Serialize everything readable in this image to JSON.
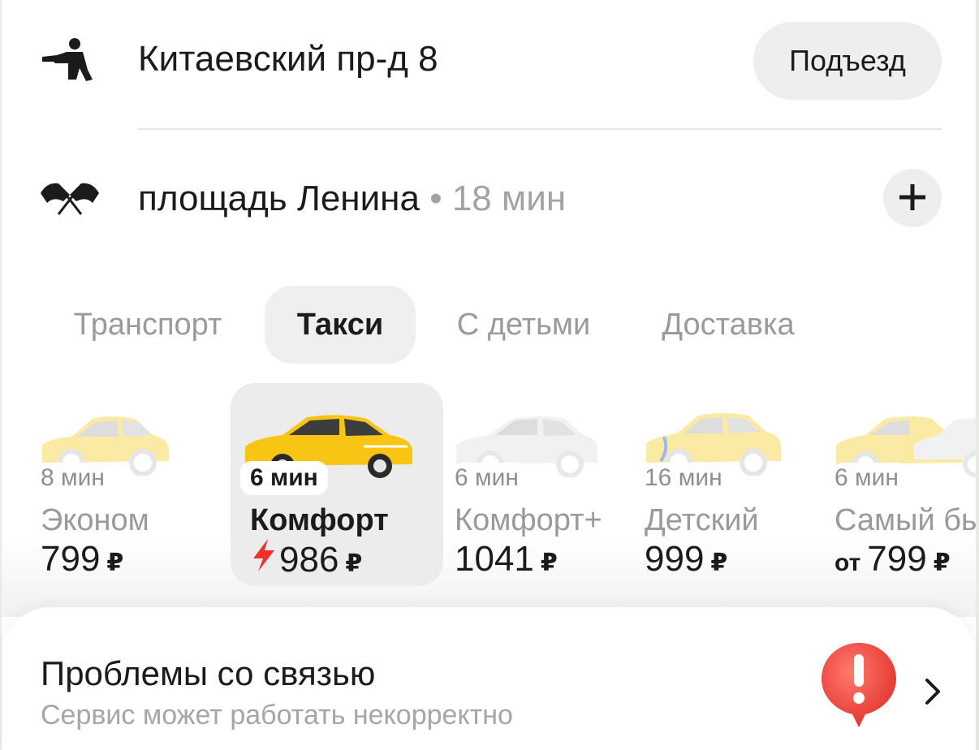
{
  "route": {
    "from": {
      "address": "Китаевский пр-д 8",
      "entrance_button": "Подъезд",
      "icon": "pickup-person-icon"
    },
    "to": {
      "address": "площадь Ленина",
      "separator": "•",
      "duration": "18 мин",
      "icon": "finish-flags-icon",
      "add_stop_icon": "plus-icon"
    }
  },
  "tabs": [
    {
      "label": "Транспорт",
      "active": false
    },
    {
      "label": "Такси",
      "active": true
    },
    {
      "label": "С детьми",
      "active": false
    },
    {
      "label": "Доставка",
      "active": false
    }
  ],
  "tariffs": [
    {
      "name": "Эконом",
      "eta": "8 мин",
      "price": "799",
      "currency": "₽",
      "prefix": "",
      "surge": false,
      "selected": false,
      "car_color": "#f7d64b"
    },
    {
      "name": "Комфорт",
      "eta": "6 мин",
      "price": "986",
      "currency": "₽",
      "prefix": "",
      "surge": true,
      "selected": true,
      "car_color": "#f9c514"
    },
    {
      "name": "Комфорт+",
      "eta": "6 мин",
      "price": "1041",
      "currency": "₽",
      "prefix": "",
      "surge": false,
      "selected": false,
      "car_color": "#e4e4e4"
    },
    {
      "name": "Детский",
      "eta": "16 мин",
      "price": "999",
      "currency": "₽",
      "prefix": "",
      "surge": false,
      "selected": false,
      "car_color": "#f7d64b"
    },
    {
      "name": "Самый бы",
      "eta": "6 мин",
      "price": "799",
      "currency": "₽",
      "prefix": "от",
      "surge": false,
      "selected": false,
      "car_color": "#f7d64b"
    }
  ],
  "notice": {
    "title": "Проблемы со связью",
    "subtitle": "Сервис может работать некорректно",
    "icon": "alert-pin-icon",
    "chevron": "chevron-right-icon"
  },
  "colors": {
    "accent_yellow": "#f9c514",
    "surge_red": "#f0302d",
    "alert_red": "#f04040"
  }
}
